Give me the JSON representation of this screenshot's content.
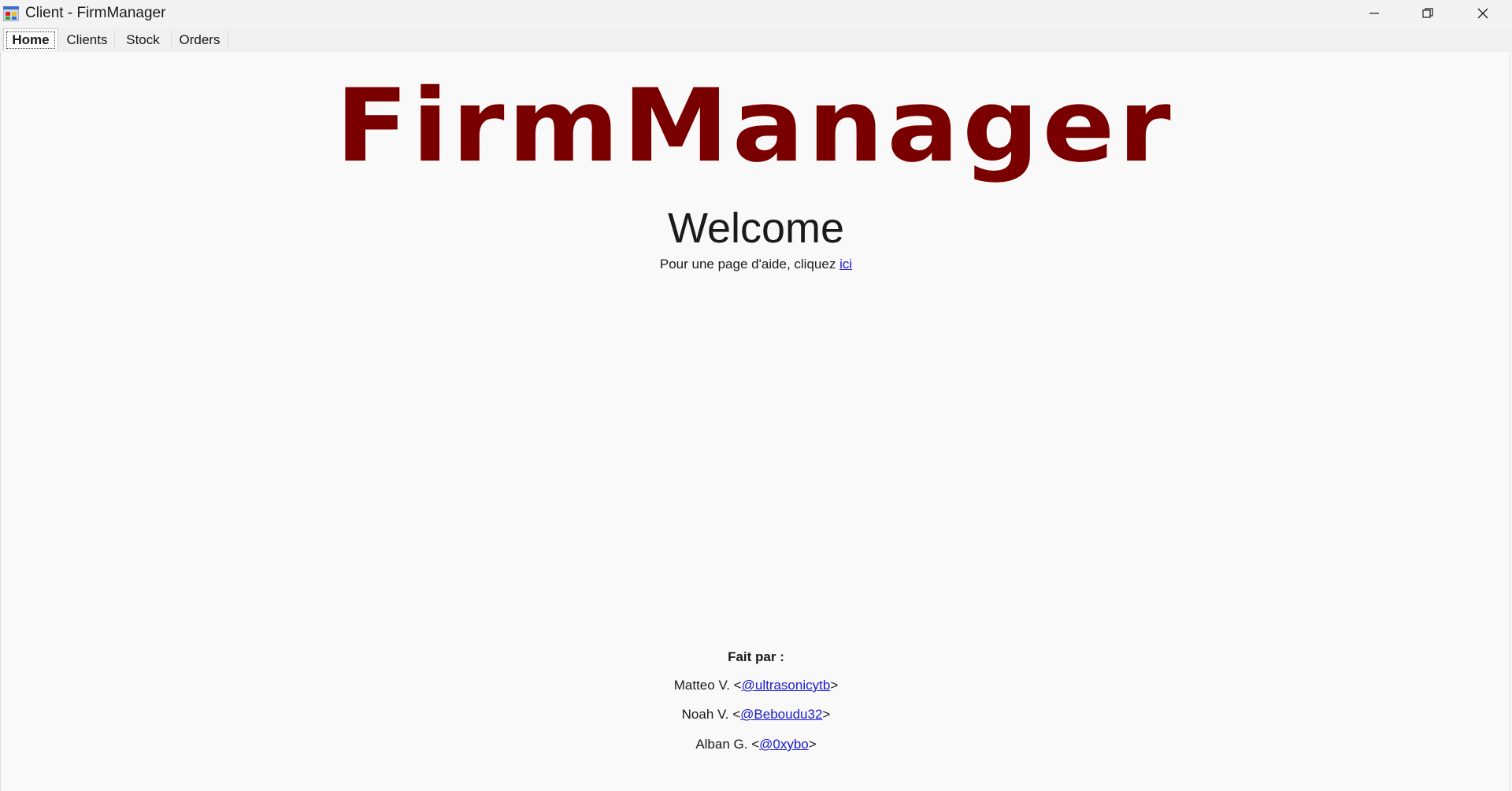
{
  "window": {
    "title": "Client - FirmManager",
    "icon": "app-window-icon",
    "controls": [
      "minimize-icon",
      "restore-icon",
      "close-icon"
    ]
  },
  "tabs": [
    {
      "label": "Home",
      "active": true
    },
    {
      "label": "Clients",
      "active": false
    },
    {
      "label": "Stock",
      "active": false
    },
    {
      "label": "Orders",
      "active": false
    }
  ],
  "home": {
    "logo_text": "FirmManager",
    "logo_color": "#7a0000",
    "welcome": "Welcome",
    "help_prefix": "Pour une page d'aide, cliquez",
    "help_link": "ici",
    "credits_title": "Fait par :",
    "credits": [
      {
        "name": "Matteo V.",
        "handle": "@ultrasonicytb"
      },
      {
        "name": "Noah V.",
        "handle": "@Beboudu32"
      },
      {
        "name": "Alban G.",
        "handle": "@0xybo"
      }
    ]
  },
  "colors": {
    "link": "#1a1acc",
    "background": "#f9f9f9"
  }
}
